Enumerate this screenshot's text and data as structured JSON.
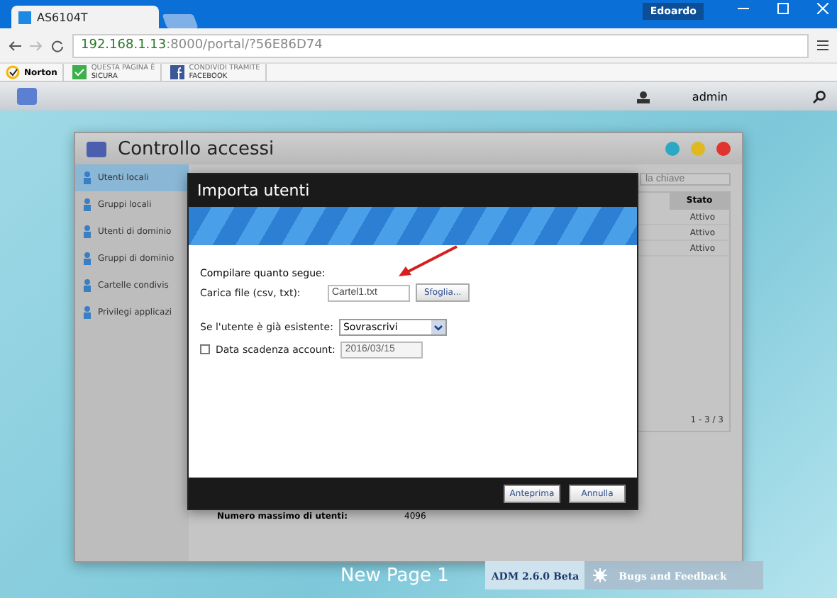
{
  "browser": {
    "profile": "Edoardo",
    "tab_title": "AS6104T",
    "url_host": "192.168.1.13",
    "url_rest": ":8000/portal/?56E86D74"
  },
  "extensions": [
    {
      "kind": "norton",
      "label": "Norton"
    },
    {
      "kind": "check",
      "line1": "QUESTA PAGINA È",
      "line2": "SICURA"
    },
    {
      "kind": "facebook",
      "line1": "CONDIVIDI TRAMITE",
      "line2": "FACEBOOK"
    }
  ],
  "app_header": {
    "user": "admin"
  },
  "window": {
    "title": "Controllo accessi",
    "sidebar": [
      {
        "label": "Utenti locali",
        "selected": true
      },
      {
        "label": "Gruppi locali",
        "selected": false
      },
      {
        "label": "Utenti di dominio",
        "selected": false
      },
      {
        "label": "Gruppi di dominio",
        "selected": false
      },
      {
        "label": "Cartelle condivis",
        "selected": false
      },
      {
        "label": "Privilegi applicazi",
        "selected": false
      }
    ],
    "search": {
      "placeholder": "la chiave"
    },
    "table": {
      "column": "Stato",
      "rows": [
        "Attivo",
        "Attivo",
        "Attivo"
      ]
    },
    "pager": "1 - 3 / 3",
    "info": {
      "label": "Numero massimo di utenti:",
      "value": "4096"
    }
  },
  "dialog": {
    "title": "Importa utenti",
    "intro": "Compilare quanto segue:",
    "file": {
      "label": "Carica file (csv, txt):",
      "value": "Cartel1.txt",
      "button": "Sfoglia..."
    },
    "existing": {
      "label": "Se l'utente è già esistente:",
      "value": "Sovrascrivi"
    },
    "expiry": {
      "label": "Data scadenza account:",
      "checked": false,
      "value": "2016/03/15"
    },
    "buttons": [
      "Anteprima",
      "Annulla"
    ]
  },
  "footer": {
    "page": "New Page 1",
    "version": "ADM 2.6.0 Beta",
    "feedback": "Bugs and Feedback"
  }
}
